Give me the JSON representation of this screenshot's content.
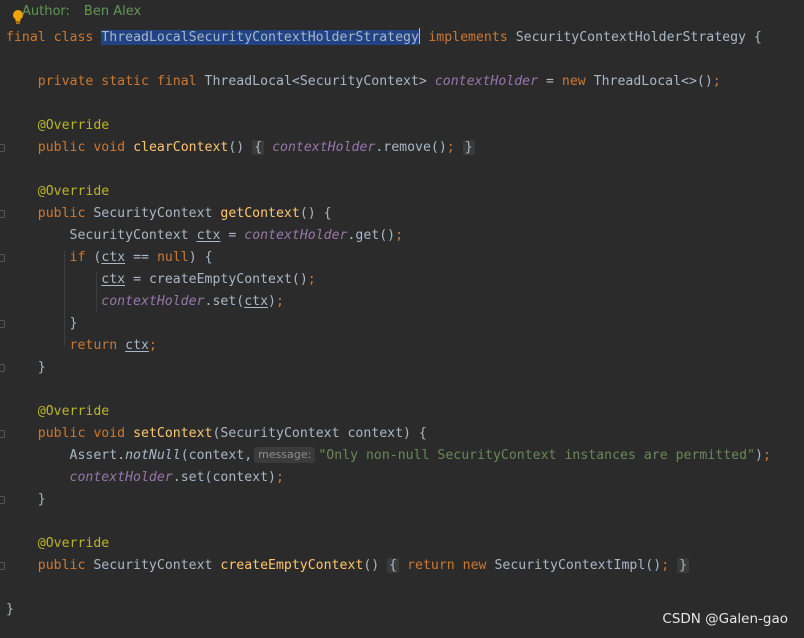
{
  "author": {
    "label": "Author:",
    "name": "Ben Alex"
  },
  "class_decl": {
    "kw_final": "final",
    "kw_class": "class",
    "name": "ThreadLocalSecurityContextHolderStrategy",
    "kw_implements": "implements",
    "iface": "SecurityContextHolderStrategy",
    "brace": "{"
  },
  "field_decl": {
    "kw_private": "private",
    "kw_static": "static",
    "kw_final": "final",
    "type": "ThreadLocal<SecurityContext>",
    "name": "contextHolder",
    "eq": "=",
    "kw_new": "new",
    "ctor": "ThreadLocal<>()",
    "semi": ";"
  },
  "override": "@Override",
  "clear": {
    "kw_public": "public",
    "kw_void": "void",
    "name": "clearContext",
    "parens": "()",
    "fold_open": "{",
    "field": "contextHolder",
    "call": ".remove()",
    "semi": ";",
    "fold_close": "}"
  },
  "get": {
    "kw_public": "public",
    "type": "SecurityContext",
    "name": "getContext",
    "params": "() {",
    "l1_type": "SecurityContext",
    "l1_var": "ctx",
    "l1_eq": "=",
    "l1_field": "contextHolder",
    "l1_call": ".get()",
    "l1_semi": ";",
    "l2_kw_if": "if",
    "l2_open": "(",
    "l2_var": "ctx",
    "l2_op": "==",
    "l2_null": "null",
    "l2_close": ") {",
    "l3_var": "ctx",
    "l3_eq": "=",
    "l3_call": "createEmptyContext()",
    "l3_semi": ";",
    "l4_field": "contextHolder",
    "l4_call": ".set(",
    "l4_var": "ctx",
    "l4_close": ")",
    "l4_semi": ";",
    "l5_brace": "}",
    "l6_kw_return": "return",
    "l6_var": "ctx",
    "l6_semi": ";",
    "l7_brace": "}"
  },
  "set": {
    "kw_public": "public",
    "kw_void": "void",
    "name": "setContext",
    "params": "(SecurityContext context) {",
    "l1_class": "Assert.",
    "l1_method": "notNull",
    "l1_args": "(context,",
    "l1_hint": "message:",
    "l1_str": "\"Only non-null SecurityContext instances are permitted\"",
    "l1_close": ")",
    "l1_semi": ";",
    "l2_field": "contextHolder",
    "l2_call": ".set(context)",
    "l2_semi": ";",
    "l3_brace": "}"
  },
  "create": {
    "kw_public": "public",
    "type": "SecurityContext",
    "name": "createEmptyContext",
    "parens": "()",
    "fold_open": "{",
    "kw_return": "return",
    "kw_new": "new",
    "ctor": "SecurityContextImpl()",
    "semi": ";",
    "fold_close": "}"
  },
  "class_close": "}",
  "watermark": "CSDN @Galen-gao"
}
